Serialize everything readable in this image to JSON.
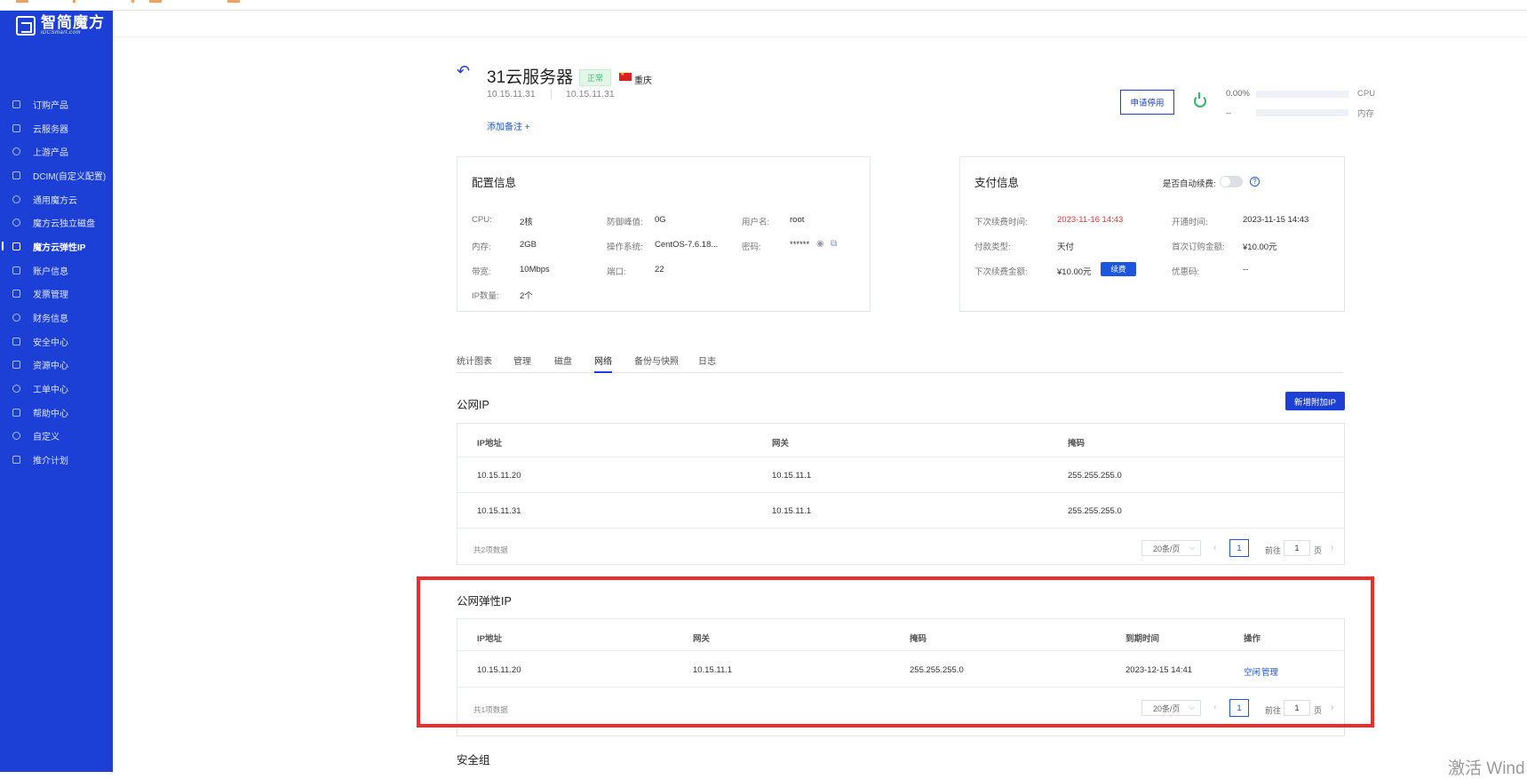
{
  "sidebar": {
    "logo_text": "智简魔方",
    "logo_sub": "iDCSmart.com",
    "items": [
      {
        "label": "订购产品",
        "icon": "cart-icon"
      },
      {
        "label": "云服务器",
        "icon": "database-icon"
      },
      {
        "label": "上游产品",
        "icon": "clock-icon"
      },
      {
        "label": "DCIM(自定义配置)",
        "icon": "document-icon"
      },
      {
        "label": "通用魔方云",
        "icon": "cloud-icon"
      },
      {
        "label": "魔方云独立磁盘",
        "icon": "disk-icon"
      },
      {
        "label": "魔方云弹性IP",
        "icon": "elastic-ip-icon",
        "active": true
      },
      {
        "label": "账户信息",
        "icon": "user-card-icon"
      },
      {
        "label": "发票管理",
        "icon": "invoice-icon"
      },
      {
        "label": "财务信息",
        "icon": "finance-icon"
      },
      {
        "label": "安全中心",
        "icon": "lock-icon"
      },
      {
        "label": "资源中心",
        "icon": "tag-icon"
      },
      {
        "label": "工单中心",
        "icon": "ticket-icon"
      },
      {
        "label": "帮助中心",
        "icon": "help-icon"
      },
      {
        "label": "自定义",
        "icon": "custom-icon"
      },
      {
        "label": "推介计划",
        "icon": "referral-icon"
      }
    ]
  },
  "header": {
    "product_name": "31云服务器",
    "status": "正常",
    "region": "重庆",
    "ip_primary": "10.15.11.31",
    "ip_secondary": "10.15.11.31",
    "add_note": "添加备注 +",
    "apply_stop": "申请停用",
    "cpu_value": "0.00%",
    "cpu_label": "CPU",
    "mem_value": "--",
    "mem_label": "内存"
  },
  "config": {
    "title": "配置信息",
    "cpu_k": "CPU:",
    "cpu_v": "2核",
    "mem_k": "内存:",
    "mem_v": "2GB",
    "bw_k": "带宽:",
    "bw_v": "10Mbps",
    "ipnum_k": "IP数量:",
    "ipnum_v": "2个",
    "ddos_k": "防御峰值:",
    "ddos_v": "0G",
    "os_k": "操作系统:",
    "os_v": "CentOS-7.6.18...",
    "port_k": "端口:",
    "port_v": "22",
    "user_k": "用户名:",
    "user_v": "root",
    "pwd_k": "密码:",
    "pwd_v": "******"
  },
  "payment": {
    "title": "支付信息",
    "auto_renew": "是否自动续费:",
    "next_due_k": "下次续费时间:",
    "next_due_v": "2023-11-16 14:43",
    "pay_type_k": "付款类型:",
    "pay_type_v": "天付",
    "next_amount_k": "下次续费金额:",
    "next_amount_v": "¥10.00元",
    "renew_btn": "续费",
    "open_time_k": "开通时间:",
    "open_time_v": "2023-11-15 14:43",
    "first_amount_k": "首次订购金额:",
    "first_amount_v": "¥10.00元",
    "coupon_k": "优惠码:",
    "coupon_v": "--"
  },
  "tabs": [
    "统计图表",
    "管理",
    "磁盘",
    "网络",
    "备份与快照",
    "日志"
  ],
  "public_ip": {
    "title": "公网IP",
    "add_button": "新增附加IP",
    "headers": [
      "IP地址",
      "网关",
      "掩码"
    ],
    "rows": [
      [
        "10.15.11.20",
        "10.15.11.1",
        "255.255.255.0"
      ],
      [
        "10.15.11.31",
        "10.15.11.1",
        "255.255.255.0"
      ]
    ],
    "total": "共2项数据",
    "page_size": "20条/页",
    "page": "1",
    "goto_label": "前往",
    "goto_value": "1",
    "page_unit": "页"
  },
  "elastic_ip": {
    "title": "公网弹性IP",
    "headers": [
      "IP地址",
      "网关",
      "掩码",
      "到期时间",
      "操作"
    ],
    "rows": [
      {
        "ip": "10.15.11.20",
        "gateway": "10.15.11.1",
        "mask": "255.255.255.0",
        "expire": "2023-12-15 14:41",
        "action1": "空闲",
        "action2": "管理"
      }
    ],
    "total": "共1项数据",
    "page_size": "20条/页",
    "page": "1",
    "goto_label": "前往",
    "goto_value": "1",
    "page_unit": "页"
  },
  "security_group": {
    "title": "安全组"
  },
  "watermark": "激活 Wind",
  "colors": {
    "accent": "#1c3fd6",
    "highlight": "#ee2c2c",
    "status_green": "#3dbb6b",
    "danger": "#e33333"
  }
}
